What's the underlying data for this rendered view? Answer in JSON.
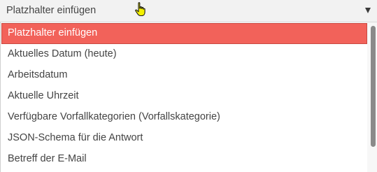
{
  "select": {
    "value": "Platzhalter einfügen"
  },
  "options": [
    {
      "label": "Platzhalter einfügen",
      "selected": true
    },
    {
      "label": "Aktuelles Datum (heute)",
      "selected": false
    },
    {
      "label": "Arbeitsdatum",
      "selected": false
    },
    {
      "label": "Aktuelle Uhrzeit",
      "selected": false
    },
    {
      "label": "Verfügbare Vorfallkategorien (Vorfallskategorie)",
      "selected": false
    },
    {
      "label": "JSON-Schema für die Antwort",
      "selected": false
    },
    {
      "label": "Betreff der E-Mail",
      "selected": false
    }
  ],
  "colors": {
    "selected_background": "#f2625a",
    "selected_text": "#ffffff",
    "text": "#444444"
  },
  "icons": {
    "caret": "chevron-down-icon",
    "cursor": "hand-pointer-icon"
  }
}
